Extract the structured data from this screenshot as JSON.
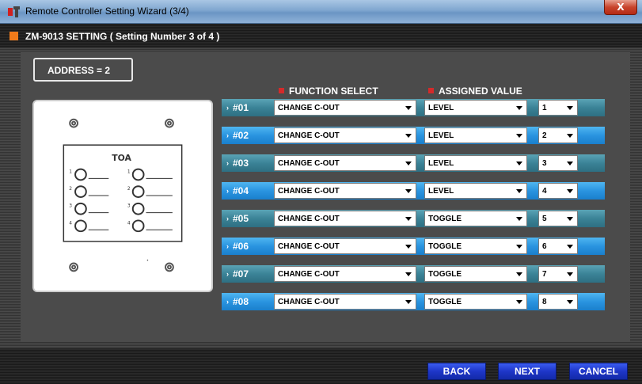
{
  "window": {
    "title": "Remote Controller Setting Wizard (3/4)",
    "close_label": "X"
  },
  "header": {
    "heading": "ZM-9013 SETTING  ( Setting Number 3 of 4 )"
  },
  "address": {
    "label": "ADDRESS = 2"
  },
  "columns": {
    "function": "FUNCTION SELECT",
    "assigned": "ASSIGNED VALUE"
  },
  "device": {
    "brand": "TOA",
    "button_numbers": [
      "1",
      "2",
      "3",
      "4"
    ]
  },
  "rows": [
    {
      "num": "#01",
      "function": "CHANGE C-OUT",
      "assigned": "LEVEL",
      "value": "1"
    },
    {
      "num": "#02",
      "function": "CHANGE C-OUT",
      "assigned": "LEVEL",
      "value": "2"
    },
    {
      "num": "#03",
      "function": "CHANGE C-OUT",
      "assigned": "LEVEL",
      "value": "3"
    },
    {
      "num": "#04",
      "function": "CHANGE C-OUT",
      "assigned": "LEVEL",
      "value": "4"
    },
    {
      "num": "#05",
      "function": "CHANGE C-OUT",
      "assigned": "TOGGLE",
      "value": "5"
    },
    {
      "num": "#06",
      "function": "CHANGE C-OUT",
      "assigned": "TOGGLE",
      "value": "6"
    },
    {
      "num": "#07",
      "function": "CHANGE C-OUT",
      "assigned": "TOGGLE",
      "value": "7"
    },
    {
      "num": "#08",
      "function": "CHANGE C-OUT",
      "assigned": "TOGGLE",
      "value": "8"
    }
  ],
  "buttons": {
    "back": "BACK",
    "next": "NEXT",
    "cancel": "CANCEL"
  },
  "colors": {
    "accent_orange": "#f07a1a",
    "header_marker_red": "#d42a2a",
    "button_blue": "#1e36c8"
  }
}
